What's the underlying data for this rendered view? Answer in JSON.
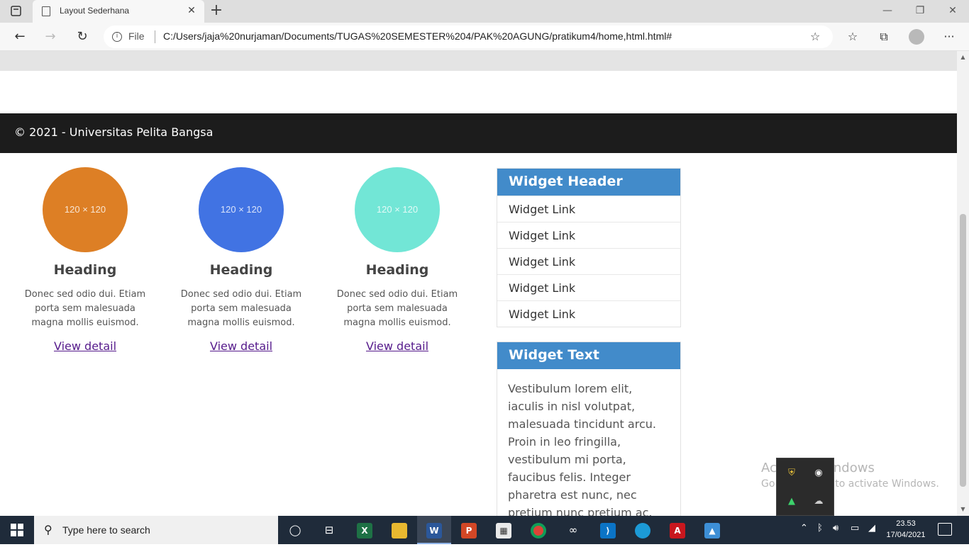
{
  "browser": {
    "tab_title": "Layout Sederhana",
    "address_scheme_label": "File",
    "url": "C:/Users/jaja%20nurjaman/Documents/TUGAS%20SEMESTER%204/PAK%20AGUNG/pratikum4/home,html.html#"
  },
  "footer": {
    "text": "© 2021 - Universitas Pelita Bangsa"
  },
  "cards": [
    {
      "placeholder": "120 × 120",
      "color": "#dd7f25",
      "heading": "Heading",
      "text": "Donec sed odio dui. Etiam porta sem malesuada magna mollis euismod.",
      "link": "View detail"
    },
    {
      "placeholder": "120 × 120",
      "color": "#4173e3",
      "heading": "Heading",
      "text": "Donec sed odio dui. Etiam porta sem malesuada magna mollis euismod.",
      "link": "View detail"
    },
    {
      "placeholder": "120 × 120",
      "color": "#72e6d6",
      "heading": "Heading",
      "text": "Donec sed odio dui. Etiam porta sem malesuada magna mollis euismod.",
      "link": "View detail"
    }
  ],
  "widget_links": {
    "header": "Widget Header",
    "links": [
      "Widget Link",
      "Widget Link",
      "Widget Link",
      "Widget Link",
      "Widget Link"
    ]
  },
  "widget_text": {
    "header": "Widget Text",
    "body": "Vestibulum lorem elit, iaculis in nisl volutpat, malesuada tincidunt arcu. Proin in leo fringilla, vestibulum mi porta, faucibus felis. Integer pharetra est nunc, nec pretium nunc pretium ac."
  },
  "watermark": {
    "title": "Activate Windows",
    "subtitle": "Go to Settings to activate Windows."
  },
  "taskbar": {
    "search_placeholder": "Type here to search",
    "time": "23.53",
    "date": "17/04/2021"
  }
}
